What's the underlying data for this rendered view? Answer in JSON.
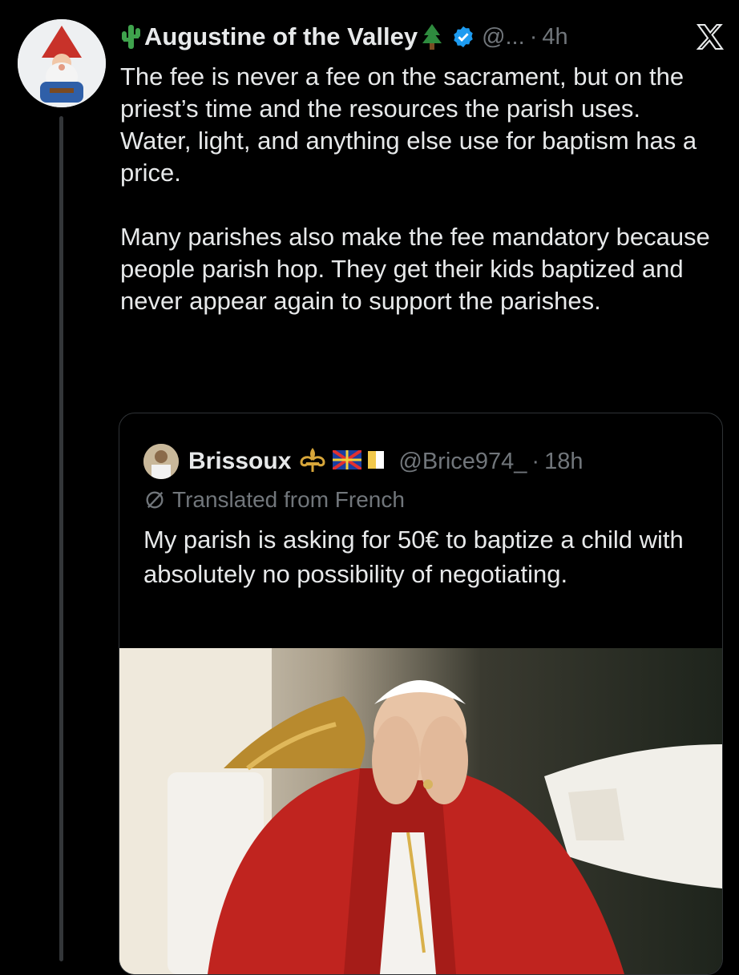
{
  "tweet": {
    "author": {
      "name": "Augustine of the Valley",
      "prefix_emoji": "🌵",
      "suffix_emoji": "🌲",
      "handle": "@...",
      "separator": "·",
      "time": "4h",
      "verified_color": "#1d9bf0"
    },
    "paragraphs": [
      "The fee is never a fee on the sacrament, but on the priest’s time and the resources the parish uses. Water, light, and anything else use for baptism has a price.",
      "Many parishes also make the fee mandatory because people parish hop. They get their kids baptized and never appear again to support the parishes."
    ]
  },
  "quote": {
    "author": {
      "name": "Brissoux",
      "handle": "@Brice974_",
      "separator": "·",
      "time": "18h"
    },
    "translated_label": "Translated from French",
    "text": "My parish is asking for 50€ to baptize a child with absolutely no possibility of negotiating."
  },
  "icons": [
    "x-logo-icon",
    "verified-badge-icon",
    "translate-icon",
    "fleur-de-lis-icon",
    "flag-icon"
  ],
  "colors": {
    "background": "#000000",
    "text": "#e7e9ea",
    "muted": "#71767b",
    "border": "#2f3336"
  }
}
